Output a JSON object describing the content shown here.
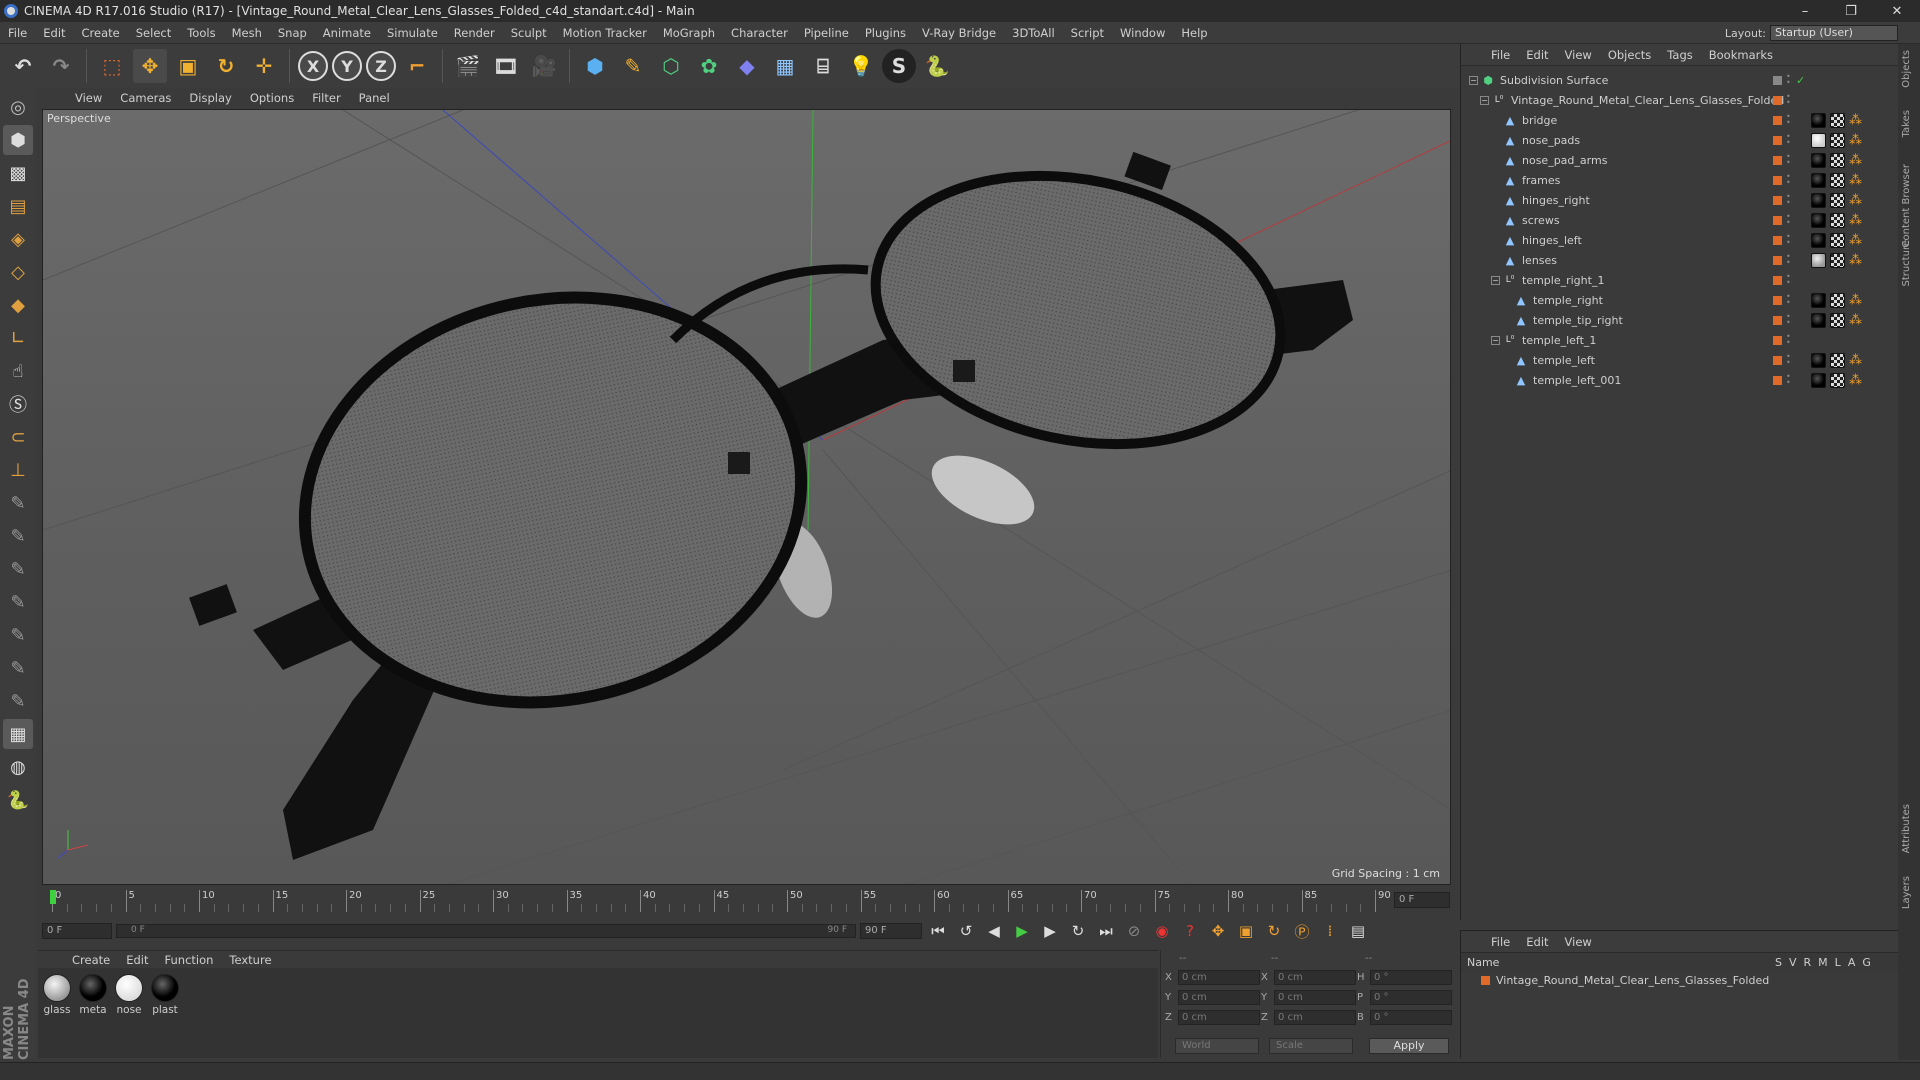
{
  "window": {
    "title": "CINEMA 4D R17.016 Studio (R17) - [Vintage_Round_Metal_Clear_Lens_Glasses_Folded_c4d_standart.c4d] - Main",
    "min": "–",
    "max": "❐",
    "close": "✕"
  },
  "menu": [
    "File",
    "Edit",
    "Create",
    "Select",
    "Tools",
    "Mesh",
    "Snap",
    "Animate",
    "Simulate",
    "Render",
    "Sculpt",
    "Motion Tracker",
    "MoGraph",
    "Character",
    "Pipeline",
    "Plugins",
    "V-Ray Bridge",
    "3DToAll",
    "Script",
    "Window",
    "Help"
  ],
  "layout": {
    "label": "Layout:",
    "value": "Startup (User)"
  },
  "viewport": {
    "menu": [
      "View",
      "Cameras",
      "Display",
      "Options",
      "Filter",
      "Panel"
    ],
    "label": "Perspective",
    "grid_spacing": "Grid Spacing : 1 cm"
  },
  "timeline": {
    "ticks": [
      "0",
      "5",
      "10",
      "15",
      "20",
      "25",
      "30",
      "35",
      "40",
      "45",
      "50",
      "55",
      "60",
      "65",
      "70",
      "75",
      "80",
      "85",
      "90"
    ],
    "current_frame": "0 F",
    "start_field": "0 F",
    "range_start": "0 F",
    "range_end": "90 F",
    "end_field": "90 F"
  },
  "materials": {
    "menu": [
      "Create",
      "Edit",
      "Function",
      "Texture"
    ],
    "items": [
      {
        "name": "glass",
        "kind": "gls"
      },
      {
        "name": "meta",
        "kind": "blk"
      },
      {
        "name": "nose",
        "kind": "wht"
      },
      {
        "name": "plast",
        "kind": "blk"
      }
    ]
  },
  "coords": {
    "header1": "--",
    "header2": "--",
    "header3": "--",
    "rows": [
      {
        "a": "X",
        "av": "0 cm",
        "b": "X",
        "bv": "0 cm",
        "c": "H",
        "cv": "0 °"
      },
      {
        "a": "Y",
        "av": "0 cm",
        "b": "Y",
        "bv": "0 cm",
        "c": "P",
        "cv": "0 °"
      },
      {
        "a": "Z",
        "av": "0 cm",
        "b": "Z",
        "bv": "0 cm",
        "c": "B",
        "cv": "0 °"
      }
    ],
    "space": "World",
    "mode": "Scale",
    "apply": "Apply"
  },
  "objects_panel": {
    "menu": [
      "File",
      "Edit",
      "View",
      "Objects",
      "Tags",
      "Bookmarks"
    ],
    "tree": [
      {
        "name": "Subdivision Surface",
        "depth": 0,
        "icon": "subdiv-icon",
        "exp": "−",
        "tags": []
      },
      {
        "name": "Vintage_Round_Metal_Clear_Lens_Glasses_Folded",
        "depth": 1,
        "icon": "null-icon",
        "exp": "−",
        "tags": []
      },
      {
        "name": "bridge",
        "depth": 2,
        "icon": "poly-icon",
        "exp": "",
        "tags": [
          "blk",
          "chk",
          "phong"
        ]
      },
      {
        "name": "nose_pads",
        "depth": 2,
        "icon": "poly-icon",
        "exp": "",
        "tags": [
          "wht",
          "chk",
          "phong"
        ]
      },
      {
        "name": "nose_pad_arms",
        "depth": 2,
        "icon": "poly-icon",
        "exp": "",
        "tags": [
          "blk",
          "chk",
          "phong"
        ]
      },
      {
        "name": "frames",
        "depth": 2,
        "icon": "poly-icon",
        "exp": "",
        "tags": [
          "blk",
          "chk",
          "phong"
        ]
      },
      {
        "name": "hinges_right",
        "depth": 2,
        "icon": "poly-icon",
        "exp": "",
        "tags": [
          "blk",
          "chk",
          "phong"
        ]
      },
      {
        "name": "screws",
        "depth": 2,
        "icon": "poly-icon",
        "exp": "",
        "tags": [
          "blk",
          "chk",
          "phong"
        ]
      },
      {
        "name": "hinges_left",
        "depth": 2,
        "icon": "poly-icon",
        "exp": "",
        "tags": [
          "blk",
          "chk",
          "phong"
        ]
      },
      {
        "name": "lenses",
        "depth": 2,
        "icon": "poly-icon",
        "exp": "",
        "tags": [
          "gls",
          "chk",
          "phong"
        ]
      },
      {
        "name": "temple_right_1",
        "depth": 2,
        "icon": "null-icon",
        "exp": "−",
        "tags": []
      },
      {
        "name": "temple_right",
        "depth": 3,
        "icon": "poly-icon",
        "exp": "",
        "tags": [
          "blk",
          "chk",
          "phong"
        ]
      },
      {
        "name": "temple_tip_right",
        "depth": 3,
        "icon": "poly-icon",
        "exp": "",
        "tags": [
          "blk",
          "chk",
          "phong"
        ]
      },
      {
        "name": "temple_left_1",
        "depth": 2,
        "icon": "null-icon",
        "exp": "−",
        "tags": []
      },
      {
        "name": "temple_left",
        "depth": 3,
        "icon": "poly-icon",
        "exp": "",
        "tags": [
          "blk",
          "chk",
          "phong"
        ]
      },
      {
        "name": "temple_left_001",
        "depth": 3,
        "icon": "poly-icon",
        "exp": "",
        "tags": [
          "blk",
          "chk",
          "phong"
        ]
      }
    ]
  },
  "layers_panel": {
    "menu": [
      "File",
      "Edit",
      "View"
    ],
    "name_header": "Name",
    "columns": [
      "S",
      "V",
      "R",
      "M",
      "L",
      "A",
      "G"
    ],
    "row": "Vintage_Round_Metal_Clear_Lens_Glasses_Folded"
  },
  "side_tabs": [
    "Objects",
    "Takes",
    "Content Browser",
    "Structure",
    "Attributes",
    "Layers"
  ],
  "brand": "MAXON CINEMA 4D",
  "colors": {
    "accent": "#e06a2a",
    "viewport_bg": "#636363",
    "panel_bg": "#3a3a3a"
  }
}
